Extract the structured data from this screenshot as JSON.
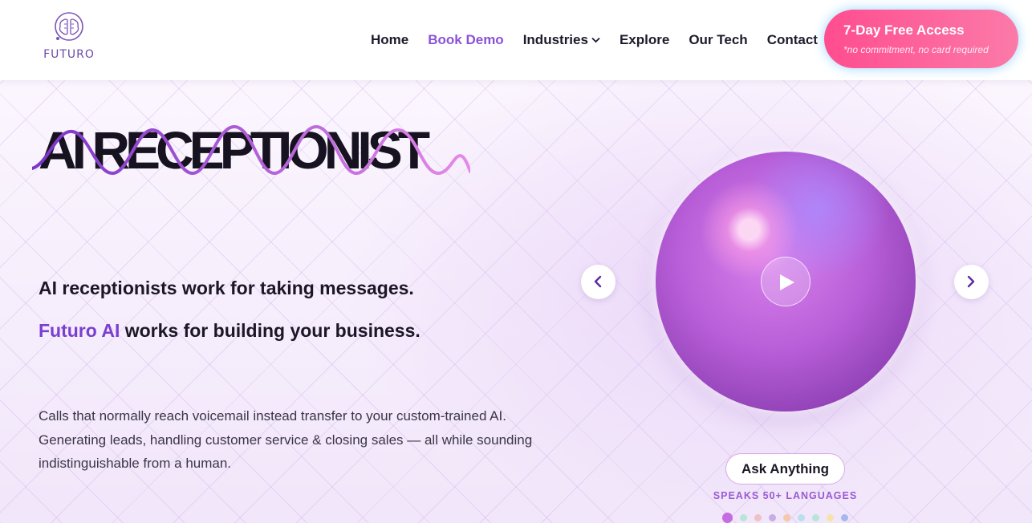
{
  "header": {
    "logo_text": "FUTURO",
    "nav": [
      {
        "label": "Home",
        "active": false
      },
      {
        "label": "Book Demo",
        "active": true
      },
      {
        "label": "Industries",
        "active": false
      },
      {
        "label": "Explore",
        "active": false
      },
      {
        "label": "Our Tech",
        "active": false
      },
      {
        "label": "Contact",
        "active": false
      }
    ],
    "cta": {
      "title": "7-Day Free Access",
      "subtitle": "*no commitment, no card required"
    }
  },
  "hero": {
    "headline": "AI RECEPTIONIST",
    "tagline_1": "AI receptionists work for taking messages.",
    "tagline_2_brand": "Futuro AI",
    "tagline_2_rest": " works for building your business.",
    "description": "Calls that normally reach voicemail instead transfer to your custom-trained AI. Generating leads, handling customer service & closing sales — all while sounding indistinguishable from a human.",
    "ask_button": "Ask Anything",
    "languages_label": "SPEAKS 50+ LANGUAGES",
    "carousel_dots": [
      "#c46de0",
      "#b6e6d8",
      "#f0c0c8",
      "#c8aee0",
      "#f5c8a8",
      "#b8e0ec",
      "#b6e6d8",
      "#f5e4a8",
      "#a8b8ec"
    ],
    "active_dot": 0
  },
  "colors": {
    "accent": "#8b52d6",
    "brand": "#7a3fcf",
    "cta_start": "#ff4d8f",
    "cta_end": "#fb7aa8"
  },
  "icons": {
    "logo": "brain-circuit-icon",
    "industries_dropdown": "chevron-down-icon",
    "play": "play-icon",
    "prev": "chevron-left-icon",
    "next": "chevron-right-icon"
  }
}
